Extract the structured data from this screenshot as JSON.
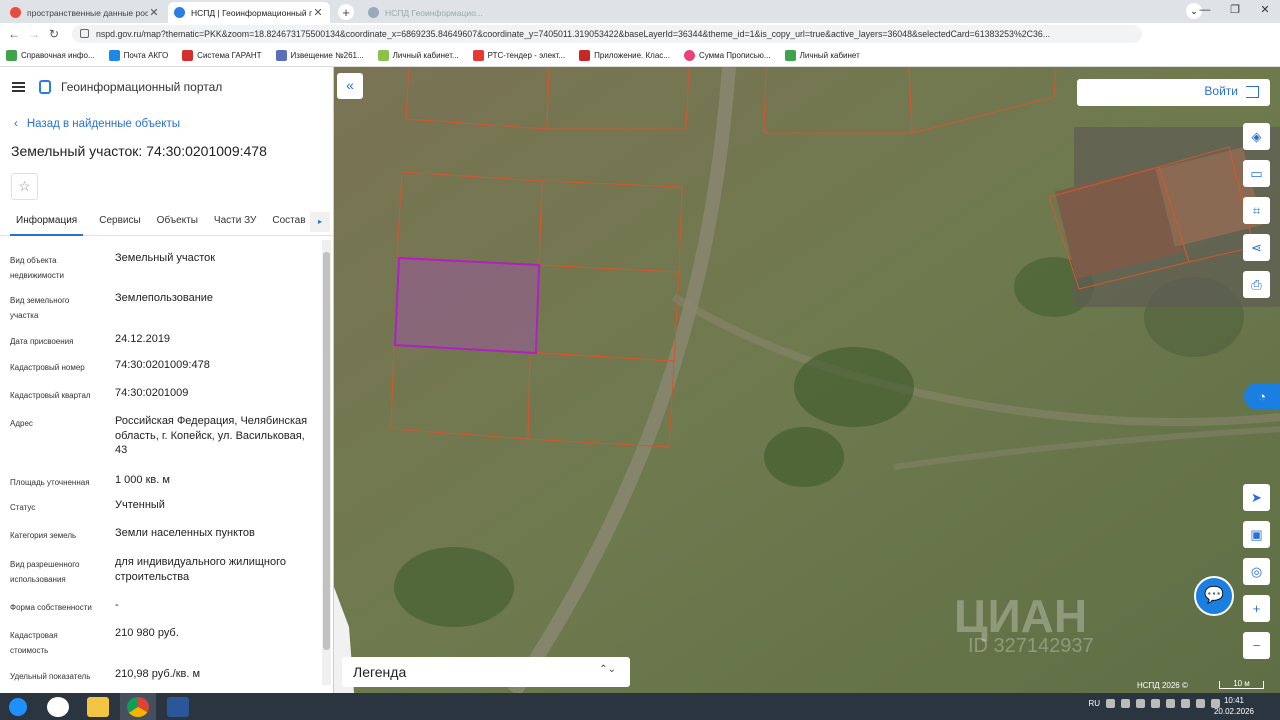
{
  "browser": {
    "tabs": [
      {
        "title": "пространственные данные рос",
        "color": "#e84c3d"
      },
      {
        "title": "НСПД | Геоинформационный п",
        "color": "#2a7de1"
      },
      {
        "title": "НСПД Геоинформацио...",
        "color": "#2a7de1"
      }
    ],
    "url": "nspd.gov.ru/map?thematic=PKK&zoom=18.824673175500134&coordinate_x=6869235.84649607&coordinate_y=7405011.319053422&baseLayerId=36344&theme_id=1&is_copy_url=true&active_layers=36048&selectedCard=61383253%2C36...",
    "bookmarks": [
      "Справочная инфо...",
      "Почта АКГО",
      "Система ГАРАНТ",
      "Извещение №261...",
      "Личный кабинет...",
      "РТС-тендер - элект...",
      "Приложение. Клас...",
      "Сумма Прописью...",
      "Личный кабинет"
    ]
  },
  "portal": {
    "title": "Геоинформационный портал",
    "back": "Назад в найденные объекты",
    "object_title": "Земельный участок: 74:30:0201009:478",
    "star": "☆"
  },
  "tabs": [
    "Информация",
    "Сервисы",
    "Объекты",
    "Части ЗУ",
    "Состав"
  ],
  "props": [
    {
      "label": "Вид объекта недвижимости",
      "value": "Земельный участок"
    },
    {
      "label": "Вид земельного участка",
      "value": "Землепользование"
    },
    {
      "label": "Дата присвоения",
      "value": "24.12.2019"
    },
    {
      "label": "Кадастровый номер",
      "value": "74:30:0201009:478"
    },
    {
      "label": "Кадастровый квартал",
      "value": "74:30:0201009"
    },
    {
      "label": "Адрес",
      "value": "Российская Федерация, Челябинская область, г. Копейск, ул. Васильковая, 43"
    },
    {
      "label": "Площадь уточненная",
      "value": "1 000 кв. м"
    },
    {
      "label": "Статус",
      "value": "Учтенный"
    },
    {
      "label": "Категория земель",
      "value": "Земли населенных пунктов"
    },
    {
      "label": "Вид разрешенного использования",
      "value": "для индивидуального жилищного строительства"
    },
    {
      "label": "Форма собственности",
      "value": "-"
    },
    {
      "label": "Кадастровая стоимость",
      "value": "210 980 руб."
    },
    {
      "label": "Удельный показатель кадастровой",
      "value": "210,98 руб./кв. м"
    }
  ],
  "map": {
    "login": "Войти",
    "legend": "Легенда",
    "copyright": "НСПД 2026 ©",
    "scale": "10 м",
    "watermark": "ЦИАН",
    "watermark_id": "ID 327142937"
  },
  "taskbar": {
    "lang": "RU",
    "time": "10:41",
    "date": "20.02.2026"
  }
}
